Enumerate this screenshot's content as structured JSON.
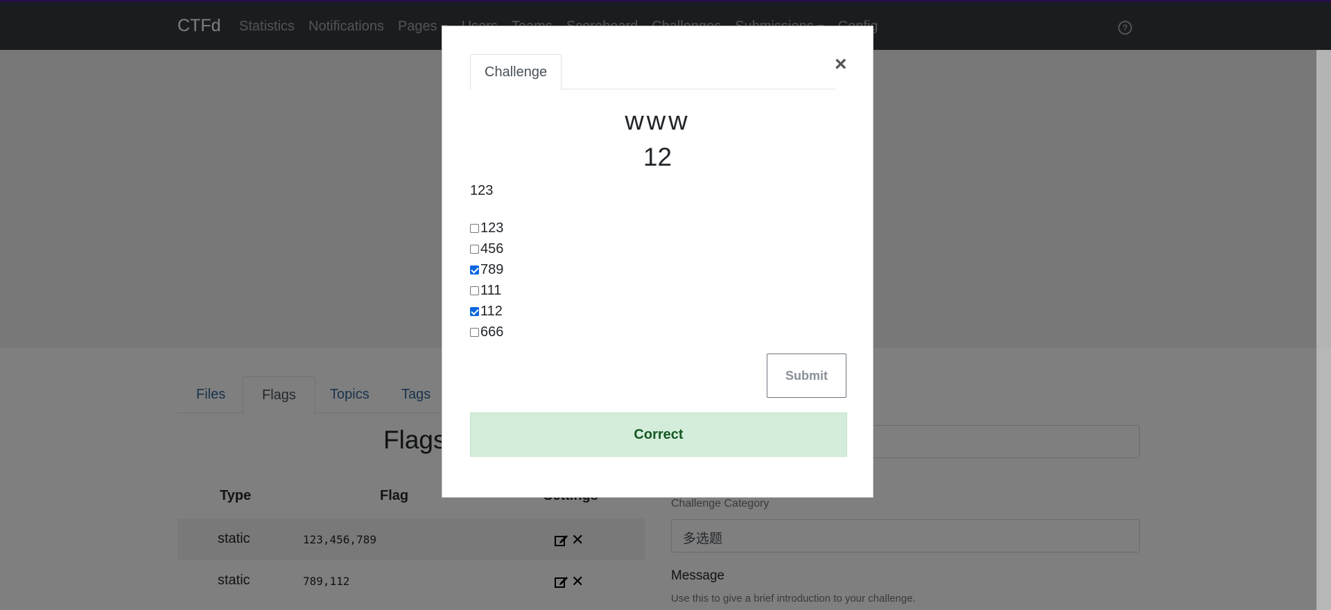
{
  "navbar": {
    "brand": "CTFd",
    "links": [
      "Statistics",
      "Notifications",
      "Pages",
      "Users",
      "Teams",
      "Scoreboard",
      "Challenges",
      "Submissions",
      "Config"
    ]
  },
  "page": {
    "tabs": [
      "Files",
      "Flags",
      "Topics",
      "Tags"
    ],
    "active_tab": "Flags",
    "flags_heading": "Flags",
    "table": {
      "headers": [
        "Type",
        "Flag",
        "Settings"
      ],
      "rows": [
        {
          "type": "static",
          "flag": "123,456,789"
        },
        {
          "type": "static",
          "flag": "789,112"
        }
      ]
    },
    "category_label": "Challenge Category",
    "category_value": "多选题",
    "message_label": "Message",
    "message_help": "Use this to give a brief introduction to your challenge."
  },
  "modal": {
    "tab": "Challenge",
    "close": "×",
    "name": "www",
    "value": "12",
    "description": "123",
    "choices": [
      {
        "label": "123",
        "checked": false
      },
      {
        "label": "456",
        "checked": false
      },
      {
        "label": "789",
        "checked": true
      },
      {
        "label": "111",
        "checked": false
      },
      {
        "label": "112",
        "checked": true
      },
      {
        "label": "666",
        "checked": false
      }
    ],
    "submit_label": "Submit",
    "result": "Correct"
  },
  "colors": {
    "navbar_bg": "#343a40",
    "success_bg": "#d4edda",
    "success_text": "#155724",
    "checkbox_checked": "#0a66e0"
  }
}
